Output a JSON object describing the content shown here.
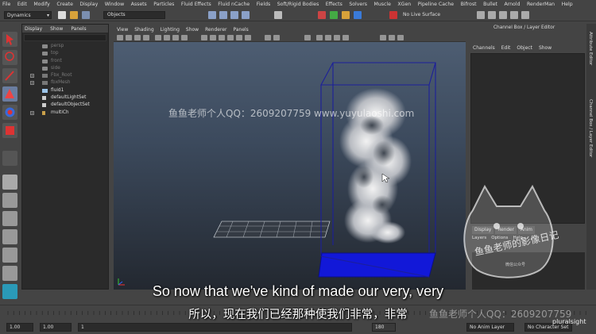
{
  "menubar": {
    "items": [
      "File",
      "Edit",
      "Modify",
      "Create",
      "Display",
      "Window",
      "Assets",
      "Particles",
      "Fluid Effects",
      "Fluid nCache",
      "Fields",
      "Soft/Rigid Bodies",
      "Effects",
      "Solvers",
      "Muscle",
      "XGen",
      "Pipeline Cache",
      "Bifrost",
      "Bullet",
      "Arnold",
      "RenderMan",
      "Help"
    ]
  },
  "statusline": {
    "mode": "Dynamics",
    "selection_field": "Objects",
    "render_label": "No Live Surface"
  },
  "outliner": {
    "menu": [
      "Display",
      "Show",
      "Panels"
    ],
    "items": [
      {
        "label": "persp",
        "dim": true,
        "expandable": false
      },
      {
        "label": "top",
        "dim": true,
        "expandable": false
      },
      {
        "label": "front",
        "dim": true,
        "expandable": false
      },
      {
        "label": "side",
        "dim": true,
        "expandable": false
      },
      {
        "label": "Fbx_Root",
        "dim": true,
        "expandable": true
      },
      {
        "label": "fbxMesh",
        "dim": true,
        "expandable": true
      },
      {
        "label": "fluid1",
        "dim": false,
        "expandable": false
      },
      {
        "label": "defaultLightSet",
        "dim": false,
        "expandable": false
      },
      {
        "label": "defaultObjectSet",
        "dim": false,
        "expandable": false
      },
      {
        "label": "multiCh",
        "dim": false,
        "expandable": true
      }
    ]
  },
  "viewport": {
    "menu": [
      "View",
      "Shading",
      "Lighting",
      "Show",
      "Renderer",
      "Panels"
    ]
  },
  "channel_box": {
    "header": "Channel Box / Layer Editor",
    "menu": [
      "Channels",
      "Edit",
      "Object",
      "Show"
    ],
    "layer_tabs": [
      "Display",
      "Render",
      "Anim"
    ],
    "layer_menu": [
      "Layers",
      "Options",
      "Help"
    ]
  },
  "side_tabs": [
    "Attribute Editor",
    "Channel Box / Layer Editor"
  ],
  "range": {
    "start": "1.00",
    "playback_start": "1.00",
    "current_frame": "1",
    "end_marker": "180",
    "anim_layer": "No Anim Layer",
    "character_set": "No Character Set"
  },
  "subtitles": {
    "english": "So now that we've kind of made our very, very",
    "chinese": "所以，现在我们已经那种使我们非常，非常"
  },
  "watermarks": {
    "top": "鱼鱼老师个人QQ：2609207759  www.yuyulaoshi.com",
    "bottom": "鱼鱼老师个人QQ：2609207759",
    "stamp_main": "鱼鱼老师的影像日记",
    "stamp_small": "微信公众号",
    "brand": "pluralsight"
  },
  "colors": {
    "ui_bg": "#444444",
    "viewport_top": "#4d5d72",
    "viewport_bottom": "#232830",
    "container_outline": "#1c1f9a",
    "container_base": "#1218d8"
  }
}
